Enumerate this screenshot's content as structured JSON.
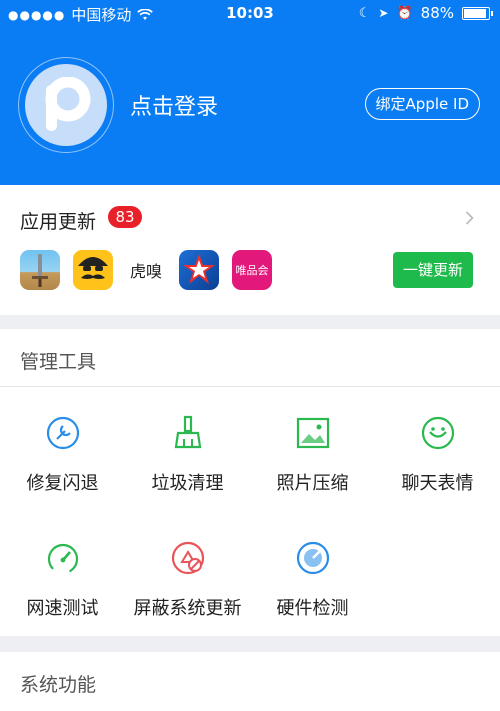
{
  "status_bar": {
    "carrier": "中国移动",
    "time": "10:03",
    "battery": "88%"
  },
  "profile": {
    "login_text": "点击登录",
    "bind_button": "绑定Apple ID"
  },
  "updates": {
    "title": "应用更新",
    "count": "83",
    "update_all_button": "一键更新",
    "apps": [
      "game-icon",
      "emoji-face-icon",
      "huxiu-icon",
      "star-sports-icon",
      "vip-shop-icon"
    ],
    "app_texts": {
      "huxiu": "虎嗅",
      "vip": "唯品会"
    }
  },
  "tools": {
    "title": "管理工具",
    "items": [
      {
        "label": "修复闪退",
        "icon": "repair-icon"
      },
      {
        "label": "垃圾清理",
        "icon": "broom-icon"
      },
      {
        "label": "照片压缩",
        "icon": "photo-icon"
      },
      {
        "label": "聊天表情",
        "icon": "chat-emoji-icon"
      },
      {
        "label": "网速测试",
        "icon": "speed-gauge-icon"
      },
      {
        "label": "屏蔽系统更新",
        "icon": "block-update-icon"
      },
      {
        "label": "硬件检测",
        "icon": "hardware-dial-icon"
      }
    ]
  },
  "system": {
    "title": "系统功能"
  },
  "colors": {
    "header_blue": "#0a7df4",
    "badge_red": "#e8202a",
    "update_green": "#1fba4c"
  }
}
